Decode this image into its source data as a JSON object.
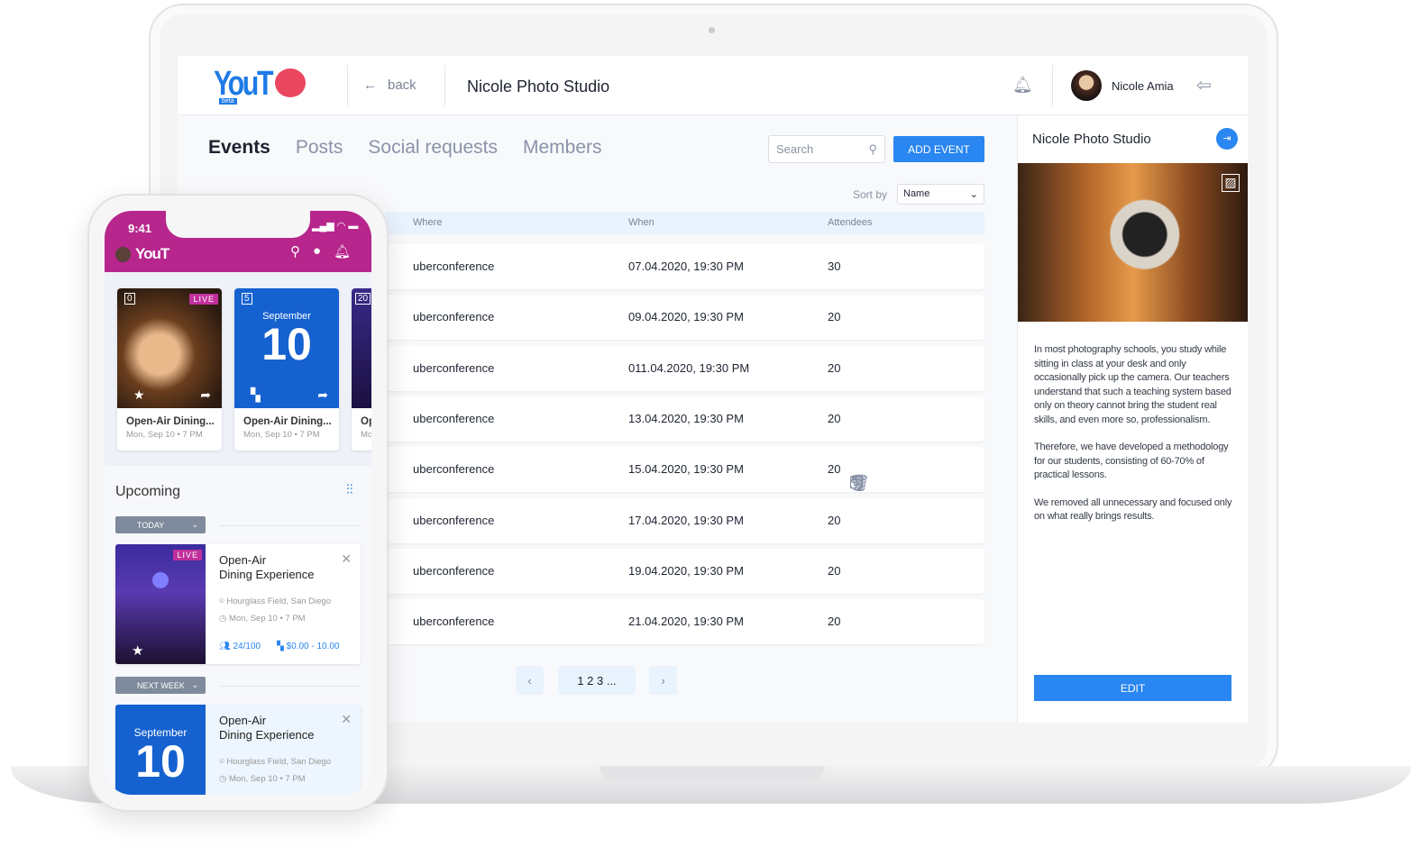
{
  "header": {
    "logo": "YouT",
    "logo_badge": "beta",
    "back_label": "back",
    "title": "Nicole Photo Studio",
    "user_name": "Nicole Amia"
  },
  "tabs": [
    {
      "label": "Events",
      "active": true
    },
    {
      "label": "Posts"
    },
    {
      "label": "Social requests"
    },
    {
      "label": "Members"
    }
  ],
  "toolbar": {
    "search_placeholder": "Search",
    "add_event_label": "ADD EVENT",
    "sort_label": "Sort by",
    "sort_value": "Name"
  },
  "table": {
    "columns": [
      "Where",
      "When",
      "Attendees"
    ],
    "rows": [
      {
        "where": "uberconference",
        "when": "07.04.2020, 19:30 PM",
        "attendees": "30"
      },
      {
        "where": "uberconference",
        "when": "09.04.2020, 19:30 PM",
        "attendees": "20"
      },
      {
        "where": "uberconference",
        "when": "011.04.2020, 19:30 PM",
        "attendees": "20"
      },
      {
        "where": "uberconference",
        "when": "13.04.2020, 19:30 PM",
        "attendees": "20"
      },
      {
        "where": "uberconference",
        "when": "15.04.2020, 19:30 PM",
        "attendees": "20",
        "hovered": true
      },
      {
        "where": "uberconference",
        "when": "17.04.2020, 19:30 PM",
        "attendees": "20"
      },
      {
        "where": "uberconference",
        "when": "19.04.2020, 19:30 PM",
        "attendees": "20"
      },
      {
        "where": "uberconference",
        "when": "21.04.2020, 19:30 PM",
        "attendees": "20"
      }
    ]
  },
  "pagination": {
    "pages": "1 2 3 ..."
  },
  "side_panel": {
    "title": "Nicole Photo Studio",
    "paragraphs": [
      "In most photography schools, you study while sitting in class at your desk and only occasionally pick up the camera. Our teachers understand that such a teaching system based only on theory cannot bring the student real skills, and even more so, professionalism.",
      "Therefore, we have developed a methodology for our students, consisting of 60-70% of practical lessons.",
      "We removed all unnecessary and focused only on what really brings results."
    ],
    "edit_label": "EDIT"
  },
  "phone": {
    "time": "9:41",
    "logo": "YouT",
    "cards": [
      {
        "title": "Open-Air Dining...",
        "date": "Mon, Sep 10 • 7 PM",
        "badge": "LIVE",
        "cal": "0"
      },
      {
        "title": "Open-Air Dining...",
        "date": "Mon, Sep 10 • 7 PM",
        "month": "September",
        "day": "10",
        "cal": "5"
      },
      {
        "title": "Op",
        "date": "Mo",
        "cal": "20"
      }
    ],
    "upcoming_title": "Upcoming",
    "groups": [
      {
        "label": "TODAY",
        "event": {
          "title1": "Open-Air",
          "title2": "Dining Experience",
          "location": "Hourglass Field, San Diego",
          "time": "Mon, Sep 10 • 7 PM",
          "attendees": "24/100",
          "price": "$0.00 - 10.00",
          "badge": "LIVE"
        }
      },
      {
        "label": "NEXT WEEK",
        "event": {
          "title1": "Open-Air",
          "title2": "Dining Experience",
          "location": "Hourglass Field, San Diego",
          "time": "Mon, Sep 10 • 7 PM",
          "month": "September",
          "day": "10"
        }
      }
    ]
  },
  "colors": {
    "accent": "#2a86f0",
    "phone_header": "#b7268c",
    "logo_bubble": "#ea4660"
  }
}
